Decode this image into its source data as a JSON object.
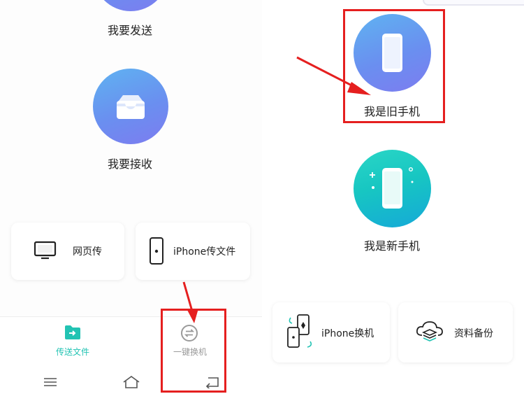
{
  "left": {
    "send_label": "我要发送",
    "receive_label": "我要接收",
    "web_transfer_label": "网页传",
    "iphone_transfer_label": "iPhone传文件",
    "tabs": [
      {
        "label": "传送文件",
        "color": "#22c3b3"
      },
      {
        "label": "一键换机",
        "color": "#9a9a9a"
      }
    ]
  },
  "right": {
    "old_phone_label": "我是旧手机",
    "new_phone_label": "我是新手机",
    "iphone_switch_label": "iPhone换机",
    "backup_label": "资料备份"
  },
  "colors": {
    "accent": "#22c3b3",
    "highlight": "#e51f1f"
  }
}
